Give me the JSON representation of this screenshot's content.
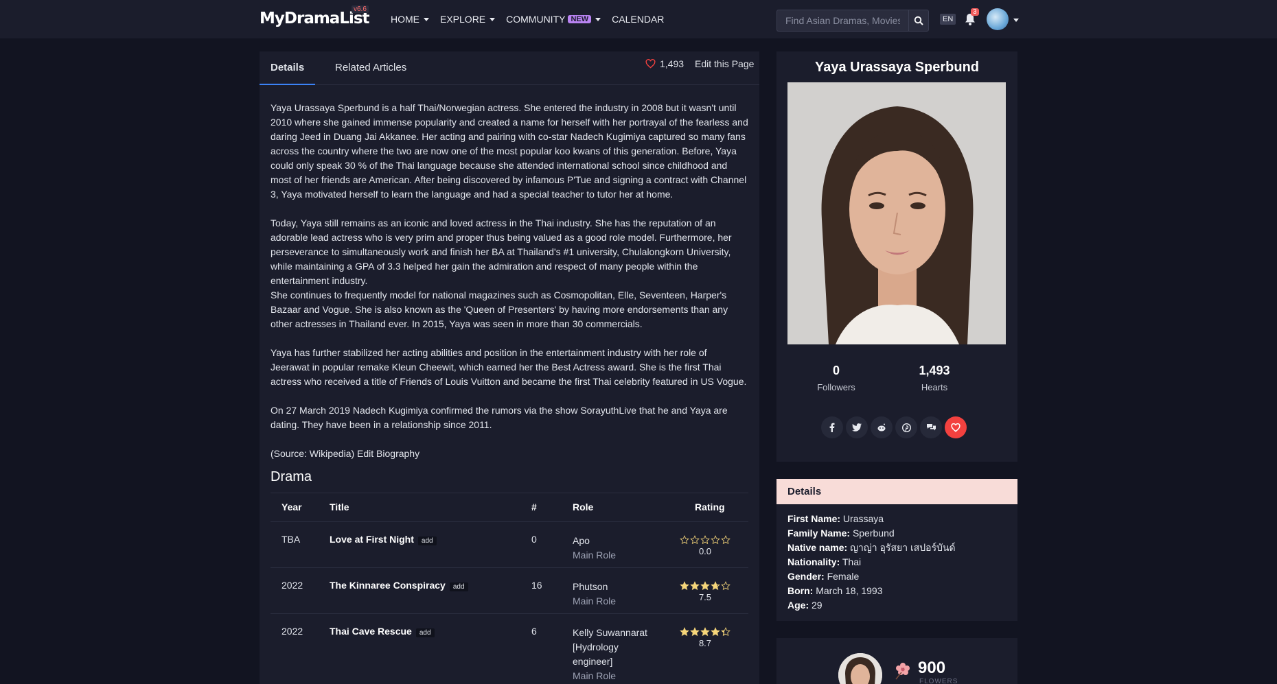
{
  "nav": {
    "logo_text": "MyDramaList",
    "logo_version": "v6.6",
    "links": [
      {
        "label": "HOME",
        "caret": true
      },
      {
        "label": "EXPLORE",
        "caret": true
      },
      {
        "label": "COMMUNITY",
        "badge": "NEW",
        "caret": true
      },
      {
        "label": "CALENDAR",
        "caret": false
      }
    ],
    "search_placeholder": "Find Asian Dramas, Movies...",
    "lang": "EN",
    "notif_count": "3"
  },
  "tabs": {
    "details": "Details",
    "related": "Related Articles"
  },
  "hearts_count": "1,493",
  "edit_page": "Edit this Page",
  "bio": {
    "p1": "Yaya Urassaya Sperbund is a half Thai/Norwegian actress. She entered the industry in 2008 but it wasn't until 2010 where she gained immense popularity and created a name for herself with her portrayal of the fearless and daring Jeed in Duang Jai Akkanee. Her acting and pairing with co-star Nadech Kugimiya captured so many fans across the country where the two are now one of the most popular koo kwans of this generation. Before, Yaya could only speak 30 % of the Thai language because she attended international school since childhood and most of her friends are American. After being discovered by infamous P'Tue and signing a contract with Channel 3, Yaya motivated herself to learn the language and had a special teacher to tutor her at home.",
    "p2": "Today, Yaya still remains as an iconic and loved actress in the Thai industry. She has the reputation of an adorable lead actress who is very prim and proper thus being valued as a good role model. Furthermore, her perseverance to simultaneously work and finish her BA at Thailand's #1 university, Chulalongkorn University, while maintaining a GPA of 3.3 helped her gain the admiration and respect of many people within the entertainment industry.",
    "p3": "She continues to frequently model for national magazines such as Cosmopolitan, Elle, Seventeen, Harper's Bazaar and Vogue. She is also known as the 'Queen of Presenters' by having more endorsements than any other actresses in Thailand ever. In 2015, Yaya was seen in more than 30 commercials.",
    "p4": "Yaya has further stabilized her acting abilities and position in the entertainment industry with her role of Jeerawat in popular remake Kleun Cheewit, which earned her the Best Actress award. She is the first Thai actress who received a title of Friends of Louis Vuitton and became the first Thai celebrity featured in US Vogue.",
    "p5": "On 27 March 2019 Nadech Kugimiya confirmed the rumors via the show SorayuthLive that he and Yaya are dating. They have been in a relationship since 2011.",
    "source": "(Source: Wikipedia) Edit Biography"
  },
  "drama": {
    "heading": "Drama",
    "columns": {
      "year": "Year",
      "title": "Title",
      "episodes": "#",
      "role": "Role",
      "rating": "Rating"
    },
    "add_label": "add",
    "rows": [
      {
        "year": "TBA",
        "title": "Love at First Night",
        "episodes": "0",
        "role": "Apo",
        "role_type": "Main Role",
        "rating": "0.0",
        "stars": 0
      },
      {
        "year": "2022",
        "title": "The Kinnaree Conspiracy",
        "episodes": "16",
        "role": "Phutson",
        "role_type": "Main Role",
        "rating": "7.5",
        "stars": 3.75
      },
      {
        "year": "2022",
        "title": "Thai Cave Rescue",
        "episodes": "6",
        "role": "Kelly Suwannarat [Hydrology engineer]",
        "role_type": "Main Role",
        "rating": "8.7",
        "stars": 4.35
      }
    ]
  },
  "profile": {
    "name": "Yaya Urassaya Sperbund",
    "followers": "0",
    "followers_label": "Followers",
    "hearts": "1,493",
    "hearts_label": "Hearts",
    "social_icons": [
      "facebook-icon",
      "twitter-icon",
      "reddit-icon",
      "pinterest-icon",
      "comments-icon",
      "heart-icon"
    ]
  },
  "details": {
    "heading": "Details",
    "items": [
      {
        "label": "First Name:",
        "value": "Urassaya"
      },
      {
        "label": "Family Name:",
        "value": "Sperbund"
      },
      {
        "label": "Native name:",
        "value": "ญาญ่า อุรัสยา เสปอร์บันด์"
      },
      {
        "label": "Nationality:",
        "value": "Thai"
      },
      {
        "label": "Gender:",
        "value": "Female"
      },
      {
        "label": "Born:",
        "value": "March 18, 1993"
      },
      {
        "label": "Age:",
        "value": "29"
      }
    ]
  },
  "flowers": {
    "count": "900",
    "label": "FLOWERS"
  },
  "colors": {
    "accent": "#3b82f6",
    "heart": "#f3413f",
    "star": "#f5d57a",
    "details_head": "#f8dcd8",
    "bg": "#121421",
    "panel": "#1b1d2c"
  }
}
